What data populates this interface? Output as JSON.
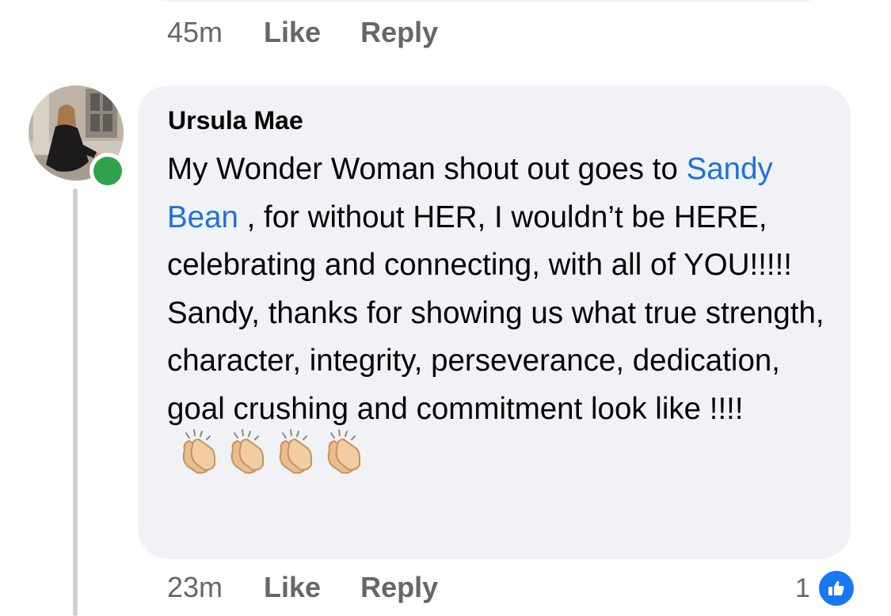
{
  "previous_comment": {
    "time": "45m",
    "like_label": "Like",
    "reply_label": "Reply"
  },
  "comment": {
    "author": "Ursula Mae",
    "text_before_mention": "My Wonder Woman shout out goes to ",
    "mention": "Sandy Bean",
    "text_after_mention": " , for without HER, I wouldn’t be HERE, celebrating and connecting, with all of YOU!!!!! Sandy, thanks for showing us what true strength, character, integrity, perseverance, dedication, goal crushing and commitment look like !!!!",
    "emoji": [
      "clapping-hands-icon",
      "clapping-hands-icon",
      "clapping-hands-icon",
      "clapping-hands-icon"
    ],
    "time": "23m",
    "like_label": "Like",
    "reply_label": "Reply",
    "reaction_count": "1",
    "online": true
  },
  "colors": {
    "bubble": "#f0f2f5",
    "mention": "#216fdb",
    "online": "#31a24c",
    "like_blue": "#1877f2",
    "secondary_text": "#65676b"
  }
}
